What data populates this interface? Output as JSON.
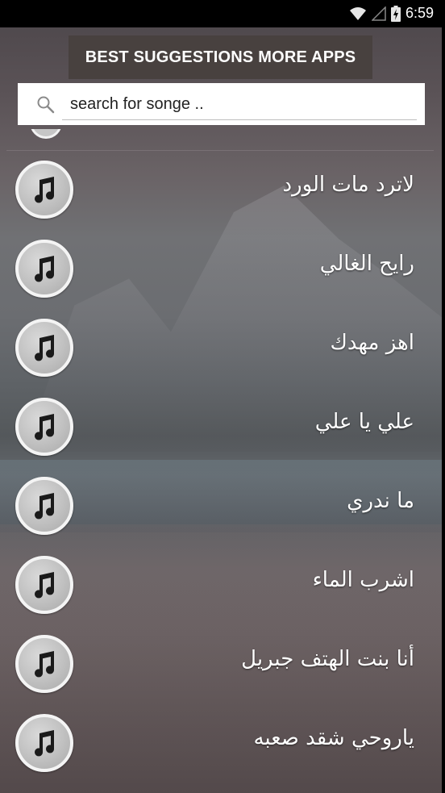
{
  "status_bar": {
    "time": "6:59",
    "icons": [
      "wifi-icon",
      "signal-icon",
      "battery-icon"
    ]
  },
  "header": {
    "more_apps_label": "BEST SUGGESTIONS MORE APPS"
  },
  "search": {
    "placeholder": "search for songe .."
  },
  "songs": [
    "لاترد مات الورد",
    "رايح الغالي",
    "اهز مهدك",
    "علي يا علي",
    "ما ندري",
    "اشرب الماء",
    "أنا بنت الهتف جبريل",
    "ياروحي شقد صعبه"
  ],
  "colors": {
    "status_bar": "#000000",
    "more_apps_button": "#48413f",
    "search_box": "#ffffff",
    "song_title": "#ffffff",
    "disc": "#c0c0c0"
  }
}
